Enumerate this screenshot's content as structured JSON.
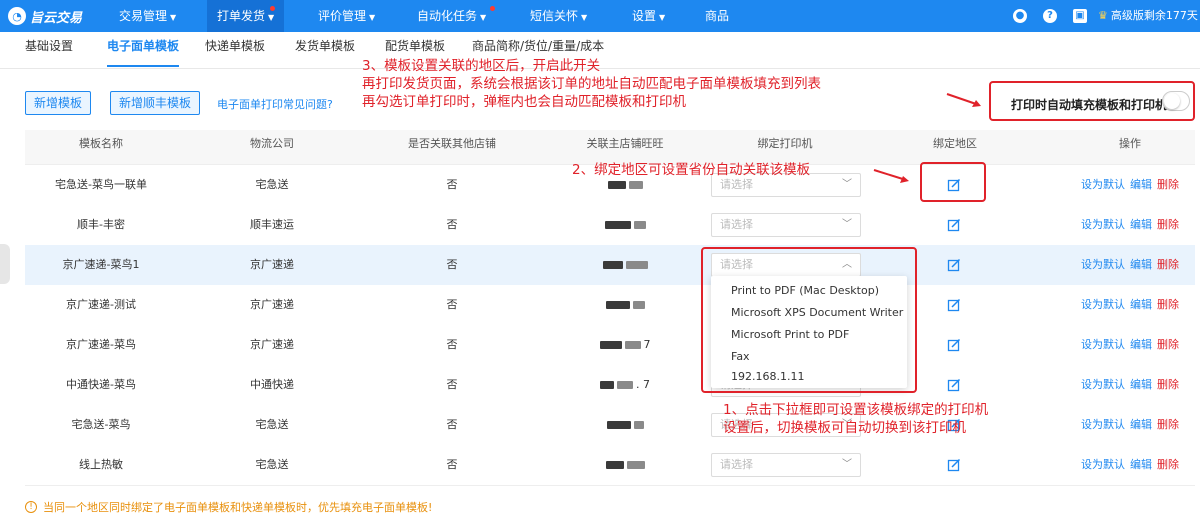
{
  "topnav": {
    "logo": "旨云交易",
    "items": [
      "交易管理",
      "打单发货",
      "评价管理",
      "自动化任务",
      "短信关怀",
      "设置",
      "商品"
    ],
    "vip": "高级版剩余177天"
  },
  "subnav": {
    "items": [
      "基础设置",
      "电子面单模板",
      "快递单模板",
      "发货单模板",
      "配货单模板",
      "商品简称/货位/重量/成本"
    ],
    "active_index": 1
  },
  "toolbar": {
    "add_template": "新增模板",
    "add_sf_template": "新增顺丰模板",
    "faq_link": "电子面单打印常见问题?"
  },
  "annotations": {
    "step3_line1": "3、模板设置关联的地区后，开启此开关",
    "step3_line2": "再打印发货页面，系统会根据该订单的地址自动匹配电子面单模板填充到列表",
    "step3_line3": "再勾选订单打印时，弹框内也会自动匹配模板和打印机",
    "step2": "2、绑定地区可设置省份自动关联该模板",
    "step1_line1": "1、点击下拉框即可设置该模板绑定的打印机",
    "step1_line2": "设置后，切换模板可自动切换到该打印机"
  },
  "auto_fill_toggle": {
    "label": "打印时自动填充模板和打印机",
    "on": false
  },
  "table": {
    "columns": [
      "模板名称",
      "物流公司",
      "是否关联其他店铺",
      "关联主店铺旺旺",
      "绑定打印机",
      "绑定地区",
      "操作"
    ],
    "select_placeholder": "请选择",
    "ops": {
      "set_default": "设为默认",
      "edit": "编辑",
      "delete": "删除"
    },
    "rows": [
      {
        "name": "宅急送-菜鸟一联单",
        "company": "宅急送",
        "linked": "否",
        "wangwang_hint": "",
        "highlighted": false,
        "dropdown_open": false
      },
      {
        "name": "顺丰-丰密",
        "company": "顺丰速运",
        "linked": "否",
        "wangwang_hint": "",
        "highlighted": false,
        "dropdown_open": false
      },
      {
        "name": "京广速递-菜鸟1",
        "company": "京广速递",
        "linked": "否",
        "wangwang_hint": "",
        "highlighted": true,
        "dropdown_open": true
      },
      {
        "name": "京广速递-测试",
        "company": "京广速递",
        "linked": "否",
        "wangwang_hint": "",
        "highlighted": false,
        "dropdown_open": false
      },
      {
        "name": "京广速递-菜鸟",
        "company": "京广速递",
        "linked": "否",
        "wangwang_hint": "7",
        "highlighted": false,
        "dropdown_open": false
      },
      {
        "name": "中通快递-菜鸟",
        "company": "中通快递",
        "linked": "否",
        "wangwang_hint": ". 7",
        "highlighted": false,
        "dropdown_open": false
      },
      {
        "name": "宅急送-菜鸟",
        "company": "宅急送",
        "linked": "否",
        "wangwang_hint": "",
        "highlighted": false,
        "dropdown_open": false
      },
      {
        "name": "线上热敏",
        "company": "宅急送",
        "linked": "否",
        "wangwang_hint": "",
        "highlighted": false,
        "dropdown_open": false
      }
    ]
  },
  "printer_dropdown": {
    "options": [
      "Print to PDF (Mac Desktop)",
      "Microsoft XPS Document Writer",
      "Microsoft Print to PDF",
      "Fax",
      "192.168.1.11"
    ]
  },
  "footer_note": "当同一个地区同时绑定了电子面单模板和快递单模板时，优先填充电子面单模板!",
  "colors": {
    "primary": "#1e88f0",
    "annotation_red": "#e0222a",
    "warning": "#e8900c"
  },
  "icons": {
    "logo": "logo-icon",
    "user": "user-icon",
    "help": "help-icon",
    "message": "message-icon",
    "crown": "crown-icon",
    "edit": "edit-icon",
    "warning": "warning-icon"
  }
}
